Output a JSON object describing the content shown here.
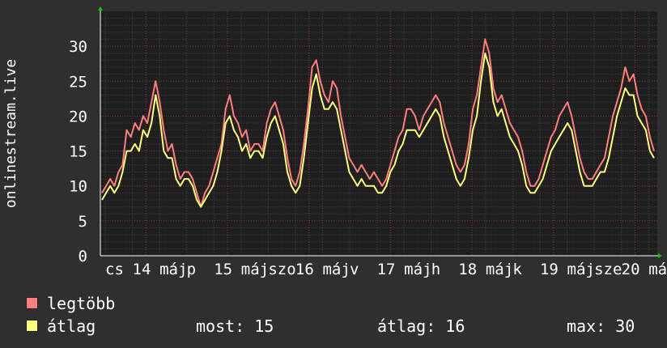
{
  "chart_data": {
    "type": "line",
    "ylabel": "onlinestream.live",
    "ylim": [
      0,
      35
    ],
    "yticks": [
      0,
      5,
      10,
      15,
      20,
      25,
      30
    ],
    "grid": true,
    "xticks": [
      "cs",
      "14",
      "máj",
      "p",
      "15",
      "máj",
      "szo",
      "16",
      "máj",
      "v",
      "17",
      "máj",
      "h",
      "18",
      "máj",
      "k",
      "19",
      "máj",
      "sze",
      "20",
      "máj"
    ],
    "series": [
      {
        "name": "legtöbb",
        "color": "#ff7f7f",
        "values": [
          9,
          10,
          11,
          10,
          12,
          13,
          18,
          17,
          19,
          18,
          20,
          19,
          22,
          25,
          22,
          18,
          15,
          16,
          13,
          11,
          12,
          12,
          11,
          9,
          7,
          9,
          10,
          12,
          14,
          16,
          21,
          23,
          20,
          19,
          17,
          18,
          15,
          16,
          16,
          15,
          19,
          21,
          22,
          20,
          18,
          14,
          11,
          10,
          12,
          16,
          21,
          27,
          28,
          25,
          23,
          22,
          25,
          24,
          20,
          17,
          14,
          13,
          12,
          13,
          12,
          11,
          12,
          11,
          10,
          11,
          13,
          15,
          17,
          18,
          21,
          21,
          20,
          18,
          20,
          21,
          22,
          23,
          22,
          19,
          17,
          15,
          13,
          12,
          13,
          16,
          21,
          23,
          27,
          31,
          29,
          24,
          22,
          23,
          21,
          19,
          18,
          17,
          15,
          12,
          10,
          10,
          11,
          13,
          15,
          17,
          18,
          20,
          21,
          22,
          20,
          17,
          14,
          12,
          11,
          11,
          12,
          13,
          14,
          17,
          20,
          22,
          24,
          27,
          25,
          26,
          23,
          21,
          20,
          17,
          15
        ]
      },
      {
        "name": "átlag",
        "color": "#ffff7f",
        "values": [
          8,
          9,
          10,
          9,
          10,
          12,
          15,
          15,
          16,
          15,
          18,
          17,
          19,
          23,
          20,
          15,
          14,
          14,
          11,
          10,
          11,
          11,
          10,
          8,
          7,
          8,
          9,
          10,
          12,
          15,
          19,
          20,
          18,
          17,
          15,
          16,
          14,
          15,
          15,
          14,
          17,
          19,
          20,
          18,
          16,
          12,
          10,
          9,
          10,
          14,
          19,
          24,
          26,
          23,
          21,
          21,
          22,
          21,
          18,
          15,
          12,
          11,
          10,
          11,
          10,
          10,
          10,
          9,
          9,
          10,
          12,
          13,
          15,
          16,
          18,
          18,
          18,
          17,
          18,
          19,
          20,
          21,
          20,
          17,
          15,
          13,
          11,
          10,
          11,
          14,
          18,
          20,
          25,
          29,
          27,
          22,
          20,
          21,
          19,
          17,
          16,
          15,
          13,
          10,
          9,
          9,
          10,
          11,
          13,
          15,
          16,
          17,
          18,
          19,
          18,
          15,
          12,
          10,
          10,
          10,
          11,
          12,
          12,
          14,
          17,
          20,
          22,
          24,
          23,
          23,
          20,
          19,
          18,
          15,
          14
        ]
      }
    ]
  },
  "legend": {
    "max_label": "legtöbb",
    "avg_label": "átlag",
    "now_text": "most: 15",
    "avg_text": "átlag: 16",
    "max_text": "max: 30"
  }
}
